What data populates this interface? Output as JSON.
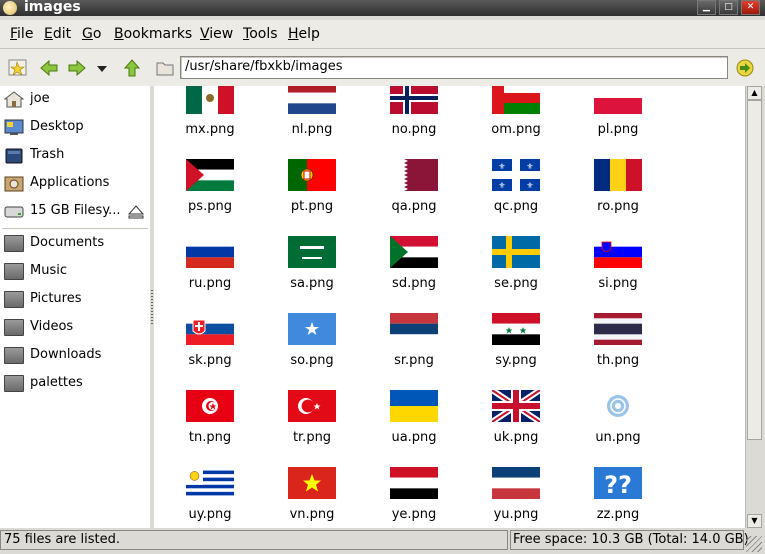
{
  "window": {
    "title": "images"
  },
  "menubar": [
    {
      "u": "F",
      "rest": "ile"
    },
    {
      "u": "E",
      "rest": "dit"
    },
    {
      "u": "G",
      "rest": "o"
    },
    {
      "u": "B",
      "rest": "ookmarks"
    },
    {
      "u": "V",
      "rest": "iew"
    },
    {
      "u": "T",
      "rest": "ools"
    },
    {
      "u": "H",
      "rest": "elp"
    }
  ],
  "toolbar": {
    "location": "/usr/share/fbxkb/images"
  },
  "sidebar": {
    "items": [
      {
        "label": "joe",
        "icon": "home-icon"
      },
      {
        "label": "Desktop",
        "icon": "desktop-icon"
      },
      {
        "label": "Trash",
        "icon": "trash-icon"
      },
      {
        "label": "Applications",
        "icon": "applications-icon"
      },
      {
        "label": "15 GB Filesy...",
        "icon": "drive-icon"
      }
    ],
    "bookmarks": [
      {
        "label": "Documents",
        "icon": "folder-icon"
      },
      {
        "label": "Music",
        "icon": "folder-icon"
      },
      {
        "label": "Pictures",
        "icon": "folder-icon"
      },
      {
        "label": "Videos",
        "icon": "folder-icon"
      },
      {
        "label": "Downloads",
        "icon": "folder-icon"
      },
      {
        "label": "palettes",
        "icon": "folder-icon"
      }
    ]
  },
  "files": [
    {
      "name": "mx.png",
      "flag": "mx"
    },
    {
      "name": "nl.png",
      "flag": "nl"
    },
    {
      "name": "no.png",
      "flag": "no"
    },
    {
      "name": "om.png",
      "flag": "om"
    },
    {
      "name": "pl.png",
      "flag": "pl"
    },
    {
      "name": "ps.png",
      "flag": "ps"
    },
    {
      "name": "pt.png",
      "flag": "pt"
    },
    {
      "name": "qa.png",
      "flag": "qa"
    },
    {
      "name": "qc.png",
      "flag": "qc"
    },
    {
      "name": "ro.png",
      "flag": "ro"
    },
    {
      "name": "ru.png",
      "flag": "ru"
    },
    {
      "name": "sa.png",
      "flag": "sa"
    },
    {
      "name": "sd.png",
      "flag": "sd"
    },
    {
      "name": "se.png",
      "flag": "se"
    },
    {
      "name": "si.png",
      "flag": "si"
    },
    {
      "name": "sk.png",
      "flag": "sk"
    },
    {
      "name": "so.png",
      "flag": "so"
    },
    {
      "name": "sr.png",
      "flag": "sr"
    },
    {
      "name": "sy.png",
      "flag": "sy"
    },
    {
      "name": "th.png",
      "flag": "th"
    },
    {
      "name": "tn.png",
      "flag": "tn"
    },
    {
      "name": "tr.png",
      "flag": "tr"
    },
    {
      "name": "ua.png",
      "flag": "ua"
    },
    {
      "name": "uk.png",
      "flag": "uk"
    },
    {
      "name": "un.png",
      "flag": "un"
    },
    {
      "name": "uy.png",
      "flag": "uy"
    },
    {
      "name": "vn.png",
      "flag": "vn"
    },
    {
      "name": "ye.png",
      "flag": "ye"
    },
    {
      "name": "yu.png",
      "flag": "yu"
    },
    {
      "name": "zz.png",
      "flag": "zz"
    }
  ],
  "status": {
    "left": "75 files are listed.",
    "right": "Free space: 10.3 GB (Total: 14.0 GB)"
  }
}
